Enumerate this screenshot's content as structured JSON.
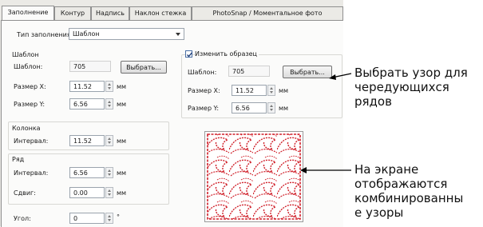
{
  "tabs": [
    "Заполнение",
    "Контур",
    "Надпись",
    "Наклон стежка",
    "PhotoSnap / Моментальное фото"
  ],
  "fill_type": {
    "label": "Тип заполнения:",
    "value": "Шаблон"
  },
  "pattern_group": {
    "title": "Шаблон",
    "pattern_label": "Шаблон:",
    "pattern_value": "705",
    "select_button": "Выбрать...",
    "size_x_label": "Размер X:",
    "size_x_value": "11.52",
    "size_x_unit": "мм",
    "size_y_label": "Размер Y:",
    "size_y_value": "6.56",
    "size_y_unit": "мм"
  },
  "alt_group": {
    "checkbox_label": "Изменить образец",
    "checked": true,
    "pattern_label": "Шаблон:",
    "pattern_value": "705",
    "select_button": "Выбрать...",
    "size_x_label": "Размер X:",
    "size_x_value": "11.52",
    "size_x_unit": "мм",
    "size_y_label": "Размер Y:",
    "size_y_value": "6.56",
    "size_y_unit": "мм"
  },
  "column_group": {
    "title": "Колонка",
    "interval_label": "Интервал:",
    "interval_value": "11.52",
    "interval_unit": "мм"
  },
  "row_group": {
    "title": "Ряд",
    "interval_label": "Интервал:",
    "interval_value": "6.56",
    "interval_unit": "мм",
    "offset_label": "Сдвиг:",
    "offset_value": "0.00",
    "offset_unit": "мм"
  },
  "angle": {
    "label": "Угол:",
    "value": "0",
    "unit": "°"
  },
  "annotations": {
    "top": [
      "Выбрать узор для",
      "чередующихся",
      "рядов"
    ],
    "bottom": [
      "На экране",
      "отображаются",
      "комбинированны",
      "е узоры"
    ]
  },
  "colors": {
    "pattern": "#d0202a",
    "panel": "#fbfbfa",
    "dialog": "#ebeae6"
  }
}
